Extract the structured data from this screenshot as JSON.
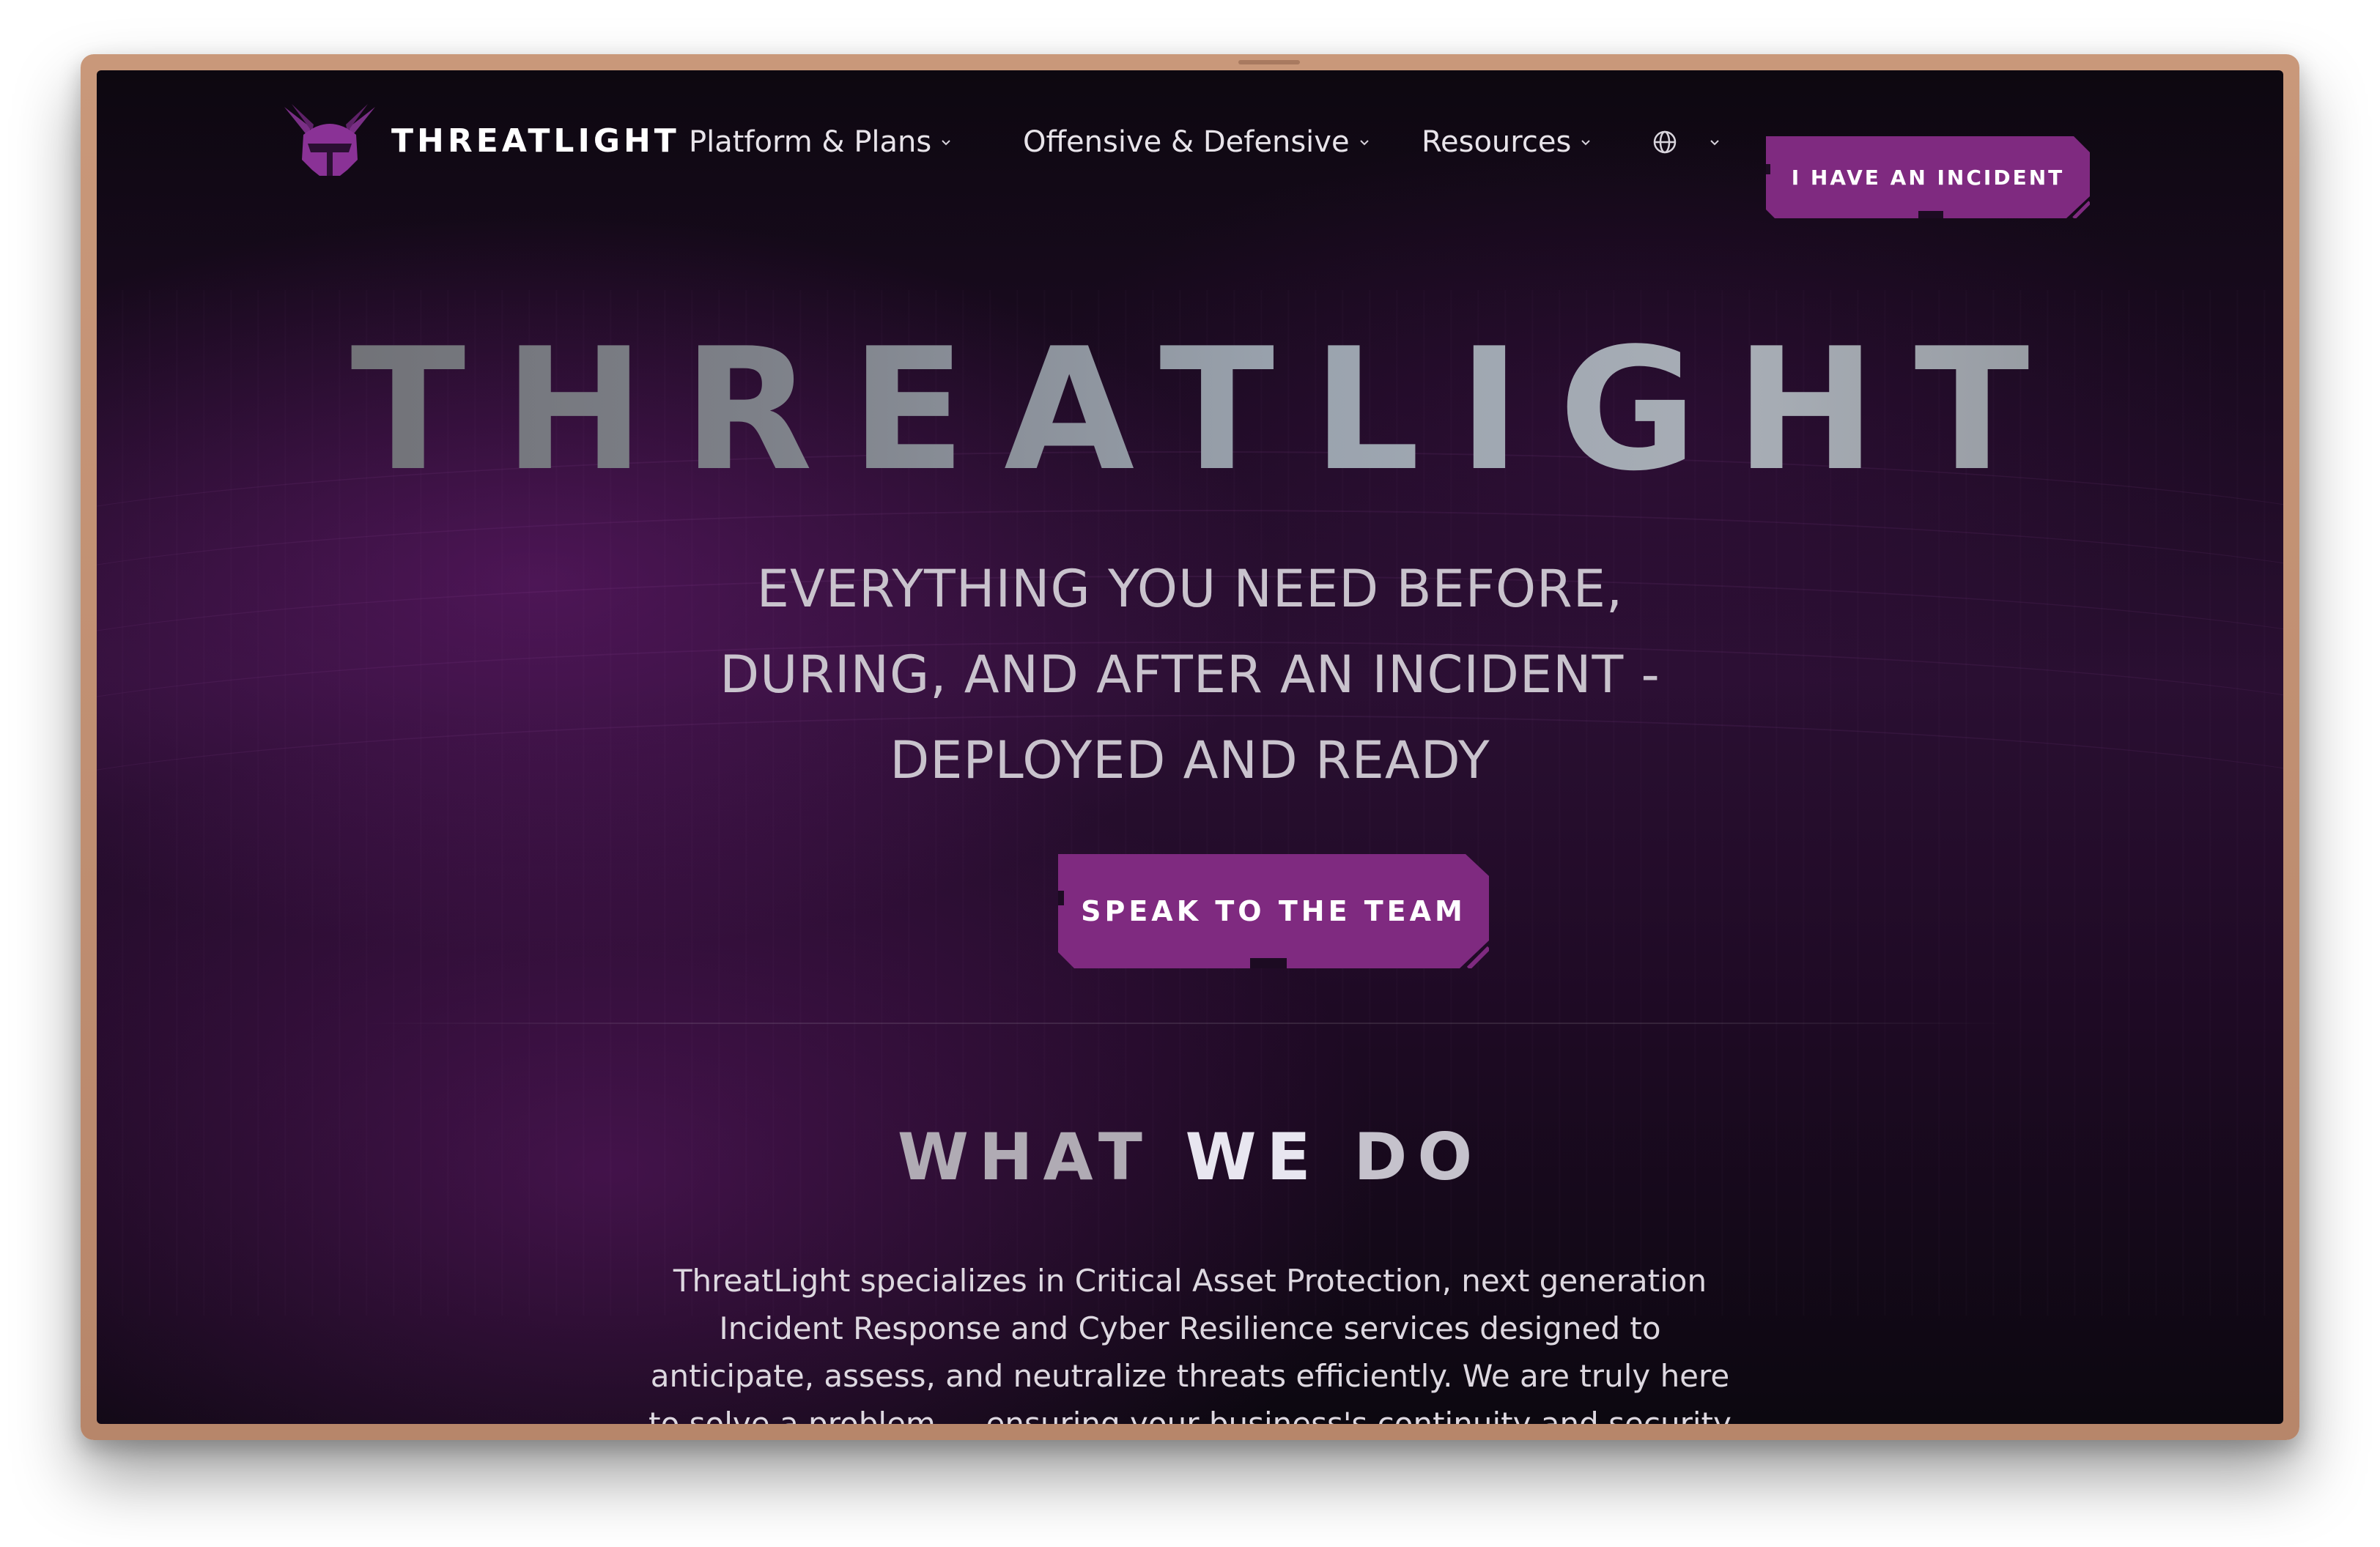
{
  "brand": {
    "name": "THREATLIGHT"
  },
  "nav": {
    "items": [
      {
        "label": "Platform & Plans"
      },
      {
        "label": "Offensive & Defensive"
      },
      {
        "label": "Resources"
      }
    ],
    "language_icon": "globe-icon",
    "incident_button": "I HAVE AN INCIDENT"
  },
  "hero": {
    "title": "THREATLIGHT",
    "subtitle_lines": [
      "EVERYTHING YOU NEED BEFORE,",
      "DURING, AND AFTER AN INCIDENT -",
      "DEPLOYED AND READY"
    ],
    "cta": "SPEAK TO THE TEAM"
  },
  "what_we_do": {
    "title_parts": [
      "WHAT",
      "WE",
      "DO"
    ],
    "body": "ThreatLight specializes in Critical Asset Protection, next generation Incident Response and Cyber Resilience services designed to anticipate, assess, and neutralize threats efficiently. We are truly here to solve a problem — ensuring your business's continuity and security"
  },
  "colors": {
    "accent": "#7f2a80",
    "background": "#1c0b22",
    "frame": "#c9987a"
  }
}
